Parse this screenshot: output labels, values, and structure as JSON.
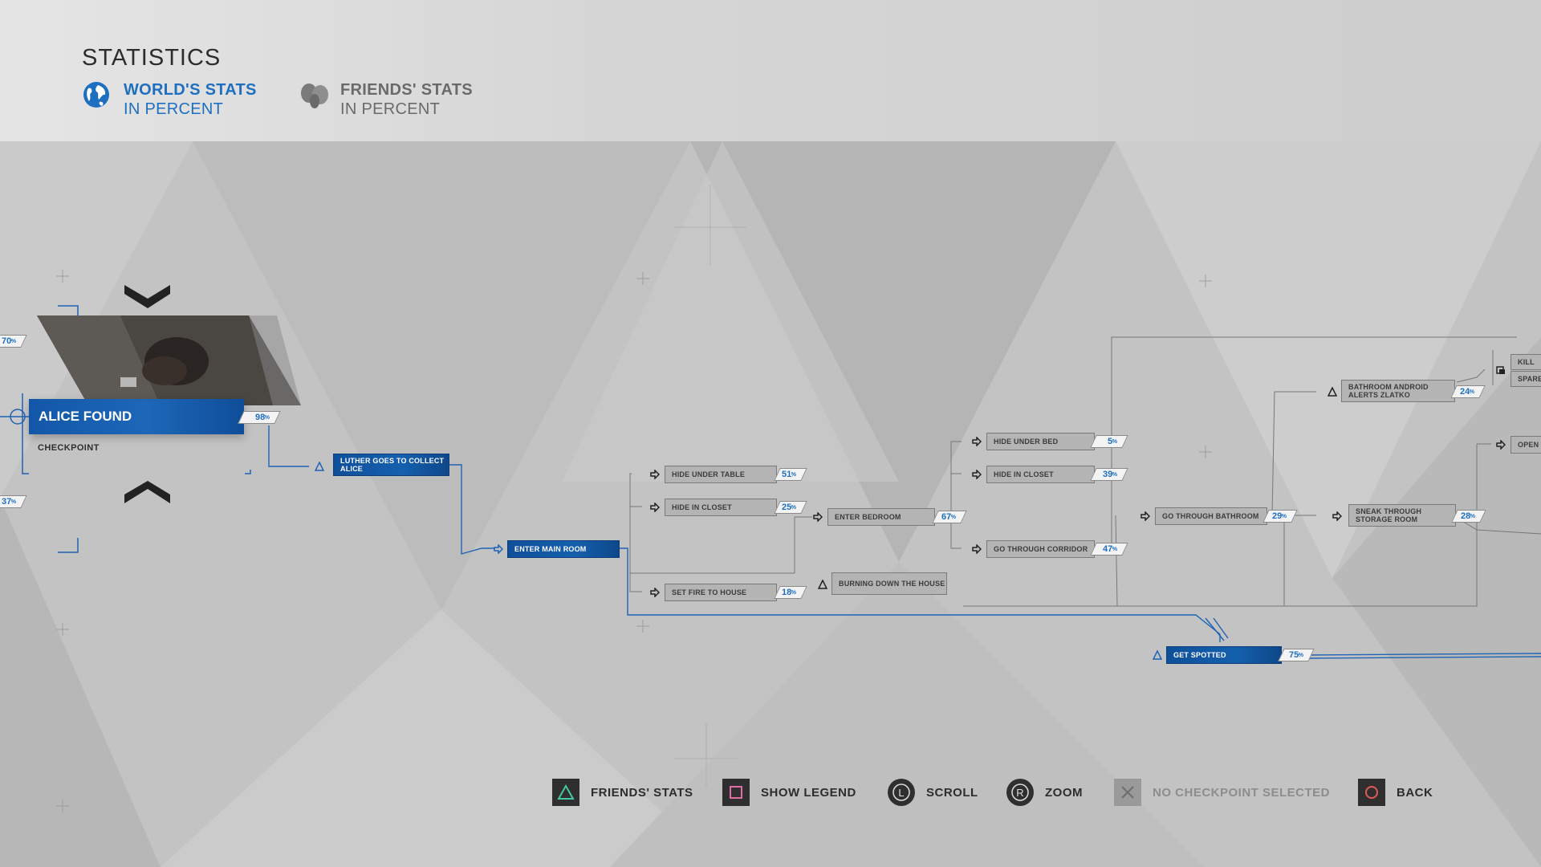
{
  "header": {
    "title": "STATISTICS",
    "tabs": [
      {
        "label": "WORLD'S STATS",
        "sub": "IN PERCENT",
        "icon": "globe-icon",
        "active": true
      },
      {
        "label": "FRIENDS' STATS",
        "sub": "IN PERCENT",
        "icon": "friends-icon",
        "active": false
      }
    ]
  },
  "checkpoint": {
    "title": "ALICE FOUND",
    "subtitle": "CHECKPOINT",
    "percent": "98",
    "side_top": "70",
    "side_bottom": "37"
  },
  "nodes": {
    "luther": "LUTHER GOES TO COLLECT ALICE",
    "main_room": "ENTER MAIN ROOM",
    "hide_table": {
      "label": "HIDE UNDER TABLE",
      "pct": "51"
    },
    "hide_closet1": {
      "label": "HIDE IN CLOSET",
      "pct": "25"
    },
    "set_fire": {
      "label": "SET FIRE TO HOUSE",
      "pct": "18"
    },
    "burning": "BURNING DOWN THE HOUSE",
    "bedroom": {
      "label": "ENTER BEDROOM",
      "pct": "67"
    },
    "hide_bed": {
      "label": "HIDE UNDER BED",
      "pct": "5"
    },
    "hide_closet2": {
      "label": "HIDE IN CLOSET",
      "pct": "39"
    },
    "corridor": {
      "label": "GO THROUGH CORRIDOR",
      "pct": "47"
    },
    "bathroom": {
      "label": "GO THROUGH BATHROOM",
      "pct": "29"
    },
    "alerts": {
      "label": "BATHROOM ANDROID ALERTS ZLATKO",
      "pct": "24"
    },
    "storage": {
      "label": "SNEAK THROUGH STORAGE ROOM",
      "pct": "28"
    },
    "spotted": {
      "label": "GET SPOTTED",
      "pct": "75"
    },
    "kill": "KILL",
    "spare": "SPARE",
    "open": "OPEN I"
  },
  "footer": [
    {
      "key": "triangle-icon",
      "label": "FRIENDS' STATS"
    },
    {
      "key": "square-icon",
      "label": "SHOW LEGEND"
    },
    {
      "key": "l-stick-icon",
      "label": "SCROLL"
    },
    {
      "key": "r-stick-icon",
      "label": "ZOOM"
    },
    {
      "key": "cross-icon",
      "label": "NO CHECKPOINT SELECTED"
    },
    {
      "key": "circle-icon",
      "label": "BACK"
    }
  ],
  "colors": {
    "accent": "#1e6fbf",
    "node_blue": "#1560ae",
    "background": "#c4c4c4"
  }
}
